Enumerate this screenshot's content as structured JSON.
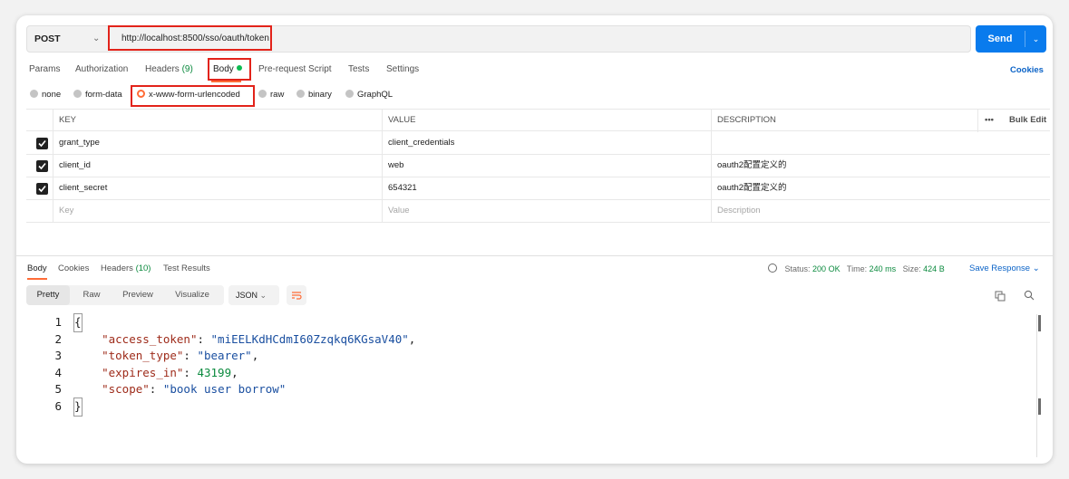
{
  "request": {
    "method": "POST",
    "url": "http://localhost:8500/sso/oauth/token",
    "send_label": "Send"
  },
  "request_tabs": [
    {
      "label": "Params"
    },
    {
      "label": "Authorization"
    },
    {
      "label": "Headers",
      "count": "(9)"
    },
    {
      "label": "Body",
      "active": true
    },
    {
      "label": "Pre-request Script"
    },
    {
      "label": "Tests"
    },
    {
      "label": "Settings"
    }
  ],
  "cookies_link": "Cookies",
  "body_types": [
    {
      "label": "none"
    },
    {
      "label": "form-data"
    },
    {
      "label": "x-www-form-urlencoded",
      "selected": true
    },
    {
      "label": "raw"
    },
    {
      "label": "binary"
    },
    {
      "label": "GraphQL"
    }
  ],
  "params_table": {
    "headers": {
      "key": "KEY",
      "value": "VALUE",
      "description": "DESCRIPTION",
      "bulk_edit": "Bulk Edit"
    },
    "rows": [
      {
        "checked": true,
        "key": "grant_type",
        "value": "client_credentials",
        "description": ""
      },
      {
        "checked": true,
        "key": "client_id",
        "value": "web",
        "description": "oauth2配置定义的"
      },
      {
        "checked": true,
        "key": "client_secret",
        "value": "654321",
        "description": "oauth2配置定义的"
      }
    ],
    "placeholders": {
      "key": "Key",
      "value": "Value",
      "description": "Description"
    }
  },
  "response": {
    "tabs": [
      {
        "label": "Body",
        "active": true
      },
      {
        "label": "Cookies"
      },
      {
        "label": "Headers",
        "count": "(10)"
      },
      {
        "label": "Test Results"
      }
    ],
    "status_label": "Status:",
    "status_value": "200 OK",
    "time_label": "Time:",
    "time_value": "240 ms",
    "size_label": "Size:",
    "size_value": "424 B",
    "save_response": "Save Response",
    "view_modes": [
      "Pretty",
      "Raw",
      "Preview",
      "Visualize"
    ],
    "format": "JSON",
    "code_lines": [
      {
        "n": "1",
        "text": "{"
      },
      {
        "n": "2",
        "key": "\"access_token\"",
        "val": "\"miEELKdHCdmI60Zzqkq6KGsaV40\"",
        "type": "string",
        "comma": true
      },
      {
        "n": "3",
        "key": "\"token_type\"",
        "val": "\"bearer\"",
        "type": "string",
        "comma": true
      },
      {
        "n": "4",
        "key": "\"expires_in\"",
        "val": "43199",
        "type": "number",
        "comma": true
      },
      {
        "n": "5",
        "key": "\"scope\"",
        "val": "\"book user borrow\"",
        "type": "string",
        "comma": false
      },
      {
        "n": "6",
        "text": "}"
      }
    ]
  },
  "colors": {
    "accent": "#ff6c37",
    "send": "#097bed",
    "link": "#0b63c7",
    "highlight_box": "#e2231a"
  }
}
